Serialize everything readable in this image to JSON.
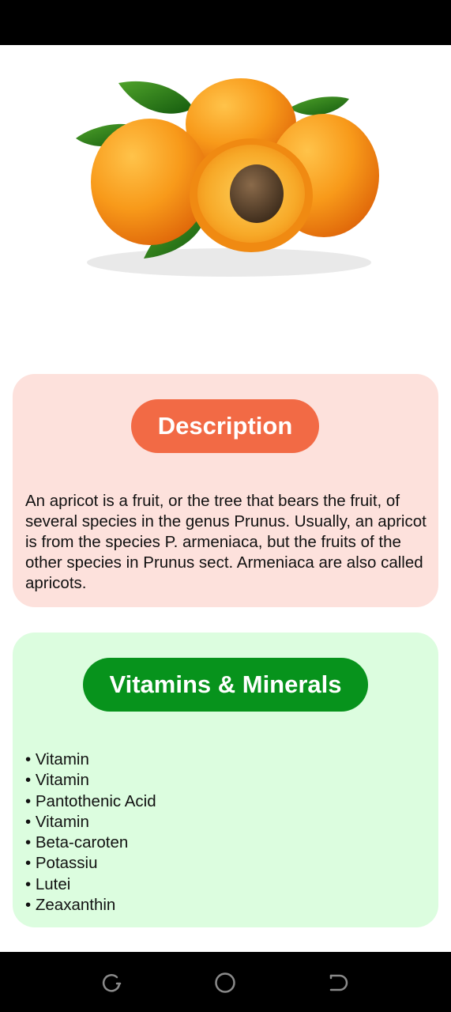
{
  "description": {
    "title": "Description",
    "text": "An apricot is a fruit, or the tree that bears the fruit, of several species in the genus Prunus. Usually, an apricot is from the species P. armeniaca, but the fruits of the other species in Prunus sect. Armeniaca are also called apricots."
  },
  "vitamins": {
    "title": "Vitamins & Minerals",
    "items": [
      "Vitamin",
      "Vitamin",
      "Pantothenic Acid",
      "Vitamin",
      "Beta-caroten",
      "Potassiu",
      "Lutei",
      "Zeaxanthin"
    ]
  },
  "colors": {
    "description_card": "#fde1dc",
    "description_pill": "#f26a45",
    "vitamins_card": "#dcfddf",
    "vitamins_pill": "#07931c"
  },
  "icons": {
    "hero": "apricot-fruit-image",
    "nav": [
      "recent-apps-icon",
      "home-icon",
      "back-icon"
    ]
  }
}
